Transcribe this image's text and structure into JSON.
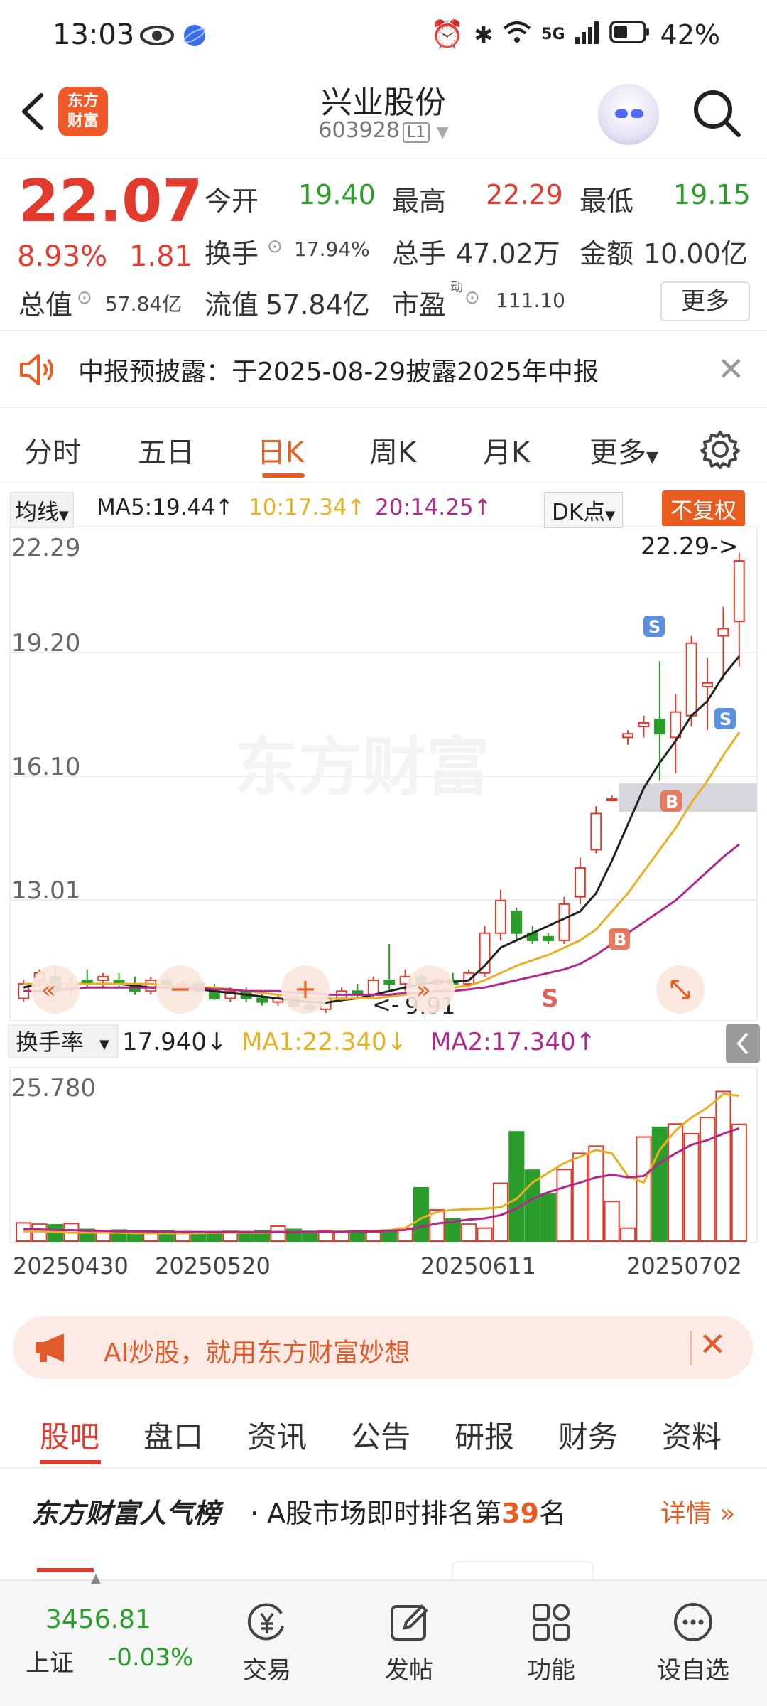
{
  "status_bar": {
    "time": "13:03",
    "battery": "42%",
    "network": "5G"
  },
  "header": {
    "logo_text": "东方财富",
    "stock_name": "兴业股份",
    "stock_code": "603928",
    "level_badge": "L1"
  },
  "quote": {
    "last_price": "22.07",
    "change_pct": "8.93%",
    "change_abs": "1.81",
    "open_label": "今开",
    "open_value": "19.40",
    "high_label": "最高",
    "high_value": "22.29",
    "low_label": "最低",
    "low_value": "19.15",
    "turnover_label": "换手",
    "turnover_value": "17.94%",
    "volume_label": "总手",
    "volume_value": "47.02万",
    "amount_label": "金额",
    "amount_value": "10.00亿",
    "total_mv_label": "总值",
    "total_mv_value": "57.84亿",
    "float_mv_label": "流值",
    "float_mv_value": "57.84亿",
    "pe_label": "市盈",
    "pe_sup": "动",
    "pe_value": "111.10",
    "more_button": "更多"
  },
  "notice": {
    "text": "中报预披露：于2025-08-29披露2025年中报"
  },
  "period_tabs": [
    {
      "label": "分时"
    },
    {
      "label": "五日"
    },
    {
      "label": "日K"
    },
    {
      "label": "周K"
    },
    {
      "label": "月K"
    },
    {
      "label": "更多"
    }
  ],
  "ma_legend": {
    "dropdown": "均线",
    "ma5": "MA5:19.44↑",
    "ma10": "10:17.34↑",
    "ma20": "20:14.25↑",
    "dk_button": "DK点",
    "adjust_button": "不复权"
  },
  "price_axis": [
    "22.29",
    "19.20",
    "16.10",
    "13.01"
  ],
  "high_marker": "22.29->",
  "low_marker": "9.91",
  "watermark": "东方财富",
  "volume_panel": {
    "dropdown": "换手率",
    "current": "17.940↓",
    "ma1": "MA1:22.340↓",
    "ma2": "MA2:17.340↑",
    "max_label": "25.780"
  },
  "date_axis": [
    "20250430",
    "20250520",
    "20250611",
    "20250702"
  ],
  "colors": {
    "up": "#e23b2e",
    "down": "#2a9d2a",
    "ma5": "#222222",
    "ma10": "#e6b022",
    "ma20": "#b0288a",
    "accent": "#e85d1f"
  },
  "chart_data": {
    "type": "candlestick",
    "ylim": [
      9.5,
      22.6
    ],
    "candles": [
      {
        "o": 10.0,
        "h": 10.5,
        "l": 9.9,
        "c": 10.4
      },
      {
        "o": 10.5,
        "h": 10.8,
        "l": 10.3,
        "c": 10.7
      },
      {
        "o": 10.6,
        "h": 10.9,
        "l": 10.1,
        "c": 10.2
      },
      {
        "o": 10.3,
        "h": 10.6,
        "l": 10.1,
        "c": 10.4
      },
      {
        "o": 10.5,
        "h": 10.8,
        "l": 10.3,
        "c": 10.4
      },
      {
        "o": 10.5,
        "h": 10.7,
        "l": 10.3,
        "c": 10.6
      },
      {
        "o": 10.5,
        "h": 10.7,
        "l": 10.3,
        "c": 10.4
      },
      {
        "o": 10.4,
        "h": 10.6,
        "l": 10.1,
        "c": 10.2
      },
      {
        "o": 10.2,
        "h": 10.6,
        "l": 10.1,
        "c": 10.5
      },
      {
        "o": 10.5,
        "h": 10.7,
        "l": 10.3,
        "c": 10.3
      },
      {
        "o": 10.3,
        "h": 10.5,
        "l": 10.2,
        "c": 10.4
      },
      {
        "o": 10.4,
        "h": 10.5,
        "l": 10.1,
        "c": 10.2
      },
      {
        "o": 10.2,
        "h": 10.4,
        "l": 9.95,
        "c": 10.0
      },
      {
        "o": 10.0,
        "h": 10.3,
        "l": 9.9,
        "c": 10.2
      },
      {
        "o": 10.2,
        "h": 10.3,
        "l": 9.9,
        "c": 10.0
      },
      {
        "o": 10.0,
        "h": 10.2,
        "l": 9.8,
        "c": 9.9
      },
      {
        "o": 9.9,
        "h": 10.1,
        "l": 9.8,
        "c": 10.0
      },
      {
        "o": 10.0,
        "h": 10.1,
        "l": 9.7,
        "c": 9.8
      },
      {
        "o": 9.8,
        "h": 10.0,
        "l": 9.6,
        "c": 9.7
      },
      {
        "o": 9.7,
        "h": 10.1,
        "l": 9.6,
        "c": 10.0
      },
      {
        "o": 10.0,
        "h": 10.3,
        "l": 9.9,
        "c": 10.2
      },
      {
        "o": 10.2,
        "h": 10.4,
        "l": 10.0,
        "c": 10.1
      },
      {
        "o": 10.1,
        "h": 10.6,
        "l": 10.0,
        "c": 10.5
      },
      {
        "o": 10.5,
        "h": 11.5,
        "l": 10.2,
        "c": 10.4
      },
      {
        "o": 10.4,
        "h": 10.8,
        "l": 10.2,
        "c": 10.6
      },
      {
        "o": 10.6,
        "h": 10.7,
        "l": 10.3,
        "c": 10.4
      },
      {
        "o": 10.4,
        "h": 10.6,
        "l": 10.2,
        "c": 10.5
      },
      {
        "o": 10.5,
        "h": 10.7,
        "l": 10.3,
        "c": 10.4
      },
      {
        "o": 10.4,
        "h": 10.8,
        "l": 10.3,
        "c": 10.7
      },
      {
        "o": 10.7,
        "h": 12.0,
        "l": 10.6,
        "c": 11.8
      },
      {
        "o": 11.8,
        "h": 13.0,
        "l": 11.6,
        "c": 12.7
      },
      {
        "o": 12.4,
        "h": 12.5,
        "l": 11.6,
        "c": 11.8
      },
      {
        "o": 11.8,
        "h": 12.0,
        "l": 11.5,
        "c": 11.6
      },
      {
        "o": 11.7,
        "h": 11.8,
        "l": 11.5,
        "c": 11.6
      },
      {
        "o": 11.6,
        "h": 12.8,
        "l": 11.5,
        "c": 12.6
      },
      {
        "o": 12.8,
        "h": 13.9,
        "l": 12.6,
        "c": 13.6
      },
      {
        "o": 14.1,
        "h": 15.3,
        "l": 14.0,
        "c": 15.1
      },
      {
        "o": 15.5,
        "h": 15.6,
        "l": 15.5,
        "c": 15.5
      },
      {
        "o": 17.2,
        "h": 17.4,
        "l": 17.0,
        "c": 17.3
      },
      {
        "o": 17.5,
        "h": 17.8,
        "l": 17.2,
        "c": 17.6
      },
      {
        "o": 17.7,
        "h": 19.3,
        "l": 16.0,
        "c": 17.3
      },
      {
        "o": 17.2,
        "h": 18.4,
        "l": 16.2,
        "c": 17.9
      },
      {
        "o": 17.8,
        "h": 20.0,
        "l": 17.5,
        "c": 19.8
      },
      {
        "o": 18.6,
        "h": 19.4,
        "l": 17.4,
        "c": 18.7
      },
      {
        "o": 20.0,
        "h": 20.8,
        "l": 18.8,
        "c": 20.2
      },
      {
        "o": 20.4,
        "h": 22.29,
        "l": 19.15,
        "c": 22.07
      }
    ],
    "ma5": [
      10.3,
      10.4,
      10.4,
      10.4,
      10.4,
      10.4,
      10.4,
      10.35,
      10.3,
      10.3,
      10.3,
      10.25,
      10.2,
      10.15,
      10.1,
      10.05,
      10.0,
      9.95,
      9.9,
      9.88,
      9.95,
      10.0,
      10.1,
      10.2,
      10.3,
      10.4,
      10.45,
      10.45,
      10.5,
      10.9,
      11.4,
      11.6,
      11.8,
      12.0,
      12.2,
      12.4,
      12.9,
      13.8,
      14.8,
      15.8,
      16.5,
      17.1,
      17.8,
      18.2,
      18.9,
      19.44
    ],
    "ma10": [
      10.4,
      10.4,
      10.4,
      10.4,
      10.4,
      10.4,
      10.4,
      10.4,
      10.4,
      10.35,
      10.35,
      10.3,
      10.3,
      10.25,
      10.2,
      10.15,
      10.1,
      10.05,
      10.0,
      10.0,
      9.98,
      10.0,
      10.0,
      10.05,
      10.1,
      10.15,
      10.2,
      10.3,
      10.35,
      10.5,
      10.7,
      10.9,
      11.05,
      11.2,
      11.4,
      11.6,
      11.9,
      12.4,
      12.9,
      13.5,
      14.1,
      14.7,
      15.4,
      16.0,
      16.7,
      17.34
    ],
    "ma20": [
      10.2,
      10.2,
      10.25,
      10.25,
      10.3,
      10.3,
      10.3,
      10.3,
      10.3,
      10.3,
      10.3,
      10.3,
      10.25,
      10.25,
      10.2,
      10.2,
      10.2,
      10.15,
      10.15,
      10.1,
      10.1,
      10.1,
      10.1,
      10.1,
      10.15,
      10.15,
      10.2,
      10.2,
      10.25,
      10.3,
      10.4,
      10.5,
      10.6,
      10.7,
      10.8,
      10.95,
      11.2,
      11.5,
      11.8,
      12.1,
      12.4,
      12.7,
      13.1,
      13.5,
      13.9,
      14.25
    ],
    "turnover": [
      2.8,
      2.6,
      2.5,
      2.7,
      1.8,
      1.6,
      1.7,
      1.5,
      1.4,
      1.6,
      1.3,
      1.4,
      1.3,
      1.5,
      1.4,
      1.6,
      2.3,
      1.8,
      1.5,
      1.6,
      1.4,
      1.5,
      1.4,
      1.5,
      2.0,
      8.2,
      4.8,
      3.4,
      2.6,
      2.0,
      8.9,
      16.8,
      10.9,
      7.2,
      11.0,
      13.5,
      14.6,
      6.1,
      2.0,
      16.0,
      17.5,
      18.0,
      16.5,
      19.0,
      23.0,
      17.94
    ],
    "turnover_ma1": [
      1.5,
      1.5,
      1.4,
      1.3,
      1.3,
      1.3,
      1.3,
      1.2,
      1.2,
      1.2,
      1.2,
      1.2,
      1.3,
      1.3,
      1.3,
      1.3,
      1.4,
      1.4,
      1.4,
      1.4,
      1.5,
      1.5,
      1.6,
      1.7,
      2.0,
      3.5,
      4.5,
      4.8,
      4.9,
      5.0,
      5.2,
      6.5,
      9.0,
      10.5,
      12.0,
      13.0,
      14.0,
      13.5,
      10.0,
      9.0,
      14.0,
      17.0,
      19.0,
      20.5,
      22.6,
      22.34
    ],
    "turnover_ma2": [
      1.8,
      1.8,
      1.7,
      1.7,
      1.6,
      1.6,
      1.5,
      1.5,
      1.5,
      1.4,
      1.4,
      1.4,
      1.4,
      1.4,
      1.4,
      1.4,
      1.4,
      1.4,
      1.4,
      1.4,
      1.4,
      1.5,
      1.5,
      1.6,
      1.7,
      2.2,
      2.7,
      3.0,
      3.3,
      3.5,
      4.0,
      5.0,
      6.5,
      7.5,
      8.3,
      9.0,
      9.8,
      10.2,
      9.8,
      10.0,
      12.0,
      13.5,
      14.8,
      15.5,
      16.5,
      17.34
    ],
    "turnover_ylim": [
      0,
      25.78
    ]
  },
  "banner": {
    "text": "AI炒股，就用东方财富妙想"
  },
  "info_tabs": [
    {
      "label": "股吧"
    },
    {
      "label": "盘口"
    },
    {
      "label": "资讯"
    },
    {
      "label": "公告"
    },
    {
      "label": "研报"
    },
    {
      "label": "财务"
    },
    {
      "label": "资料"
    }
  ],
  "popularity": {
    "title": "东方财富人气榜",
    "text_prefix": "· A股市场即时排名第",
    "rank": "39",
    "text_suffix": "名",
    "detail_link": "详情"
  },
  "bottom_nav": {
    "index_value": "3456.81",
    "index_name": "上证",
    "index_change": "-0.03%",
    "items": [
      {
        "label": "交易",
        "icon": "yen-icon"
      },
      {
        "label": "发帖",
        "icon": "edit-icon"
      },
      {
        "label": "功能",
        "icon": "grid-icon"
      },
      {
        "label": "设自选",
        "icon": "more-icon"
      }
    ]
  }
}
